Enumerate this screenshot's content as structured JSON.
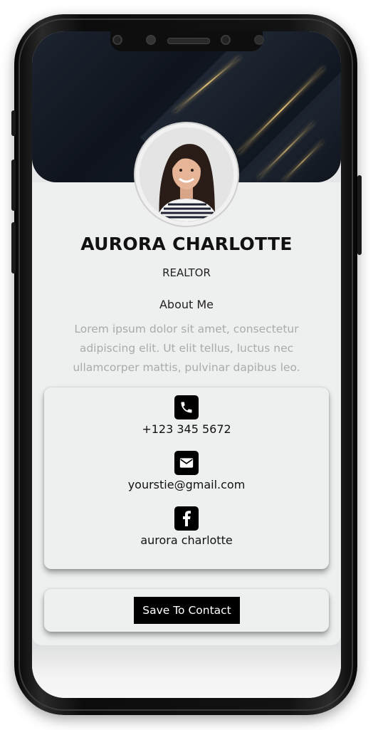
{
  "profile": {
    "name": "AURORA CHARLOTTE",
    "title": "REALTOR",
    "about_heading": "About Me",
    "about_text": "Lorem ipsum dolor sit amet, consectetur adipiscing elit. Ut elit tellus, luctus nec ullamcorper mattis, pulvinar dapibus leo."
  },
  "contacts": {
    "phone": {
      "icon": "phone-icon",
      "value": "+123 345 5672"
    },
    "email": {
      "icon": "envelope-icon",
      "value": "yourstie@gmail.com"
    },
    "facebook": {
      "icon": "facebook-icon",
      "value": "aurora charlotte"
    }
  },
  "actions": {
    "save_label": "Save To Contact"
  },
  "colors": {
    "hero_bg": "#141b25",
    "accent_gold": "#e8c57a",
    "card_bg": "#eeefef",
    "icon_bg": "#000000",
    "button_bg": "#000000",
    "about_text": "#a9aaab"
  }
}
